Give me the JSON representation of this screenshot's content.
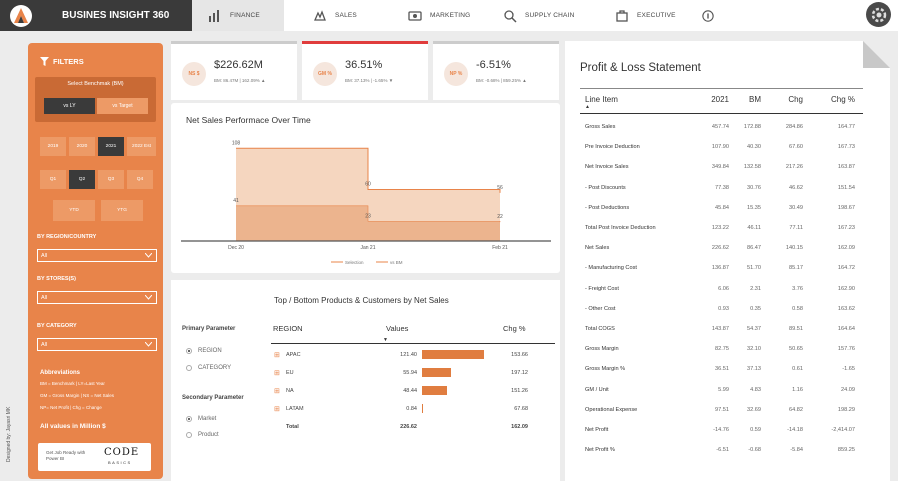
{
  "app": {
    "brand": "BUSINES INSIGHT 360"
  },
  "nav": {
    "tabs": [
      {
        "label": "FINANCE",
        "icon": "finance-icon"
      },
      {
        "label": "SALES",
        "icon": "sales-icon"
      },
      {
        "label": "MARKETING",
        "icon": "marketing-icon"
      },
      {
        "label": "SUPPLY CHAIN",
        "icon": "supply-chain-icon"
      },
      {
        "label": "EXECUTIVE",
        "icon": "executive-icon"
      }
    ]
  },
  "filters": {
    "title": "FILTERS",
    "benchmark_label": "Select Benchmak (BM)",
    "benchmark_options": [
      "vs LY",
      "vs Target"
    ],
    "years": [
      "2019",
      "2020",
      "2021",
      "2022 Est"
    ],
    "quarters": [
      "Q1",
      "Q2",
      "Q3",
      "Q4"
    ],
    "periods": [
      "YTD",
      "YTG"
    ],
    "region_label": "BY REGION/COUNTRY",
    "region_value": "All",
    "stores_label": "BY STORES(S)",
    "stores_value": "All",
    "category_label": "BY CATEGORY",
    "category_value": "All",
    "abbr_title": "Abbreviations",
    "abbr_lines": [
      "BM = Benchmark | LY=Last Year",
      "GM = Gross Margin | NS = Net Sales",
      "NP= Net Profit | Chg = Change"
    ],
    "values_note": "All values in Million $",
    "promo_text": "Get Job Ready with Power BI",
    "promo_logo": "CODE",
    "promo_sub": "BASICS",
    "designed_by": "Designed by: Jayasri MK"
  },
  "kpis": [
    {
      "badge": "NS $",
      "value": "$226.62M",
      "sub": "BM: 86.47M | 162.09% ▲"
    },
    {
      "badge": "GM %",
      "value": "36.51%",
      "sub": "BM: 37.13% | -1.65% ▼"
    },
    {
      "badge": "NP %",
      "value": "-6.51%",
      "sub": "BM: -0.68% | 859.25% ▲"
    }
  ],
  "chart_data": {
    "type": "area",
    "title": "Net Sales Performace Over Time",
    "categories": [
      "Dec 20",
      "Jan 21",
      "Feb 21"
    ],
    "series": [
      {
        "name": "Selection",
        "values": [
          108,
          60,
          56
        ]
      },
      {
        "name": "vs BM",
        "values": [
          41,
          23,
          22
        ]
      }
    ],
    "ylim": [
      0,
      120
    ],
    "grid": false,
    "legend": "bottom",
    "colors": {
      "Selection": "#f5d6bf",
      "vs BM": "#ecb48e",
      "line": "#e8844a"
    }
  },
  "params": {
    "primary_title": "Primary Parameter",
    "primary_options": [
      "REGION",
      "CATEGORY"
    ],
    "secondary_title": "Secondary Parameter",
    "secondary_options": [
      "Market",
      "Product"
    ]
  },
  "top_bottom": {
    "title": "Top / Bottom Products & Customers by Net Sales",
    "headers": {
      "dim": "REGION",
      "values": "Values",
      "chg": "Chg %"
    },
    "rows": [
      {
        "name": "APAC",
        "value": "121.40",
        "num": 121.4,
        "chg": "153.66"
      },
      {
        "name": "EU",
        "value": "55.94",
        "num": 55.94,
        "chg": "197.12"
      },
      {
        "name": "NA",
        "value": "48.44",
        "num": 48.44,
        "chg": "151.26"
      },
      {
        "name": "LATAM",
        "value": "0.84",
        "num": 0.84,
        "chg": "67.68"
      }
    ],
    "total": {
      "name": "Total",
      "value": "226.62",
      "chg": "162.09"
    }
  },
  "pl": {
    "title": "Profit & Loss Statement",
    "headers": [
      "Line Item",
      "2021",
      "BM",
      "Chg",
      "Chg %"
    ],
    "rows": [
      [
        "Gross Sales",
        "457.74",
        "172.88",
        "284.86",
        "164.77"
      ],
      [
        "Pre Invoice Deduction",
        "107.90",
        "40.30",
        "67.60",
        "167.73"
      ],
      [
        "Net Invoice Sales",
        "349.84",
        "132.58",
        "217.26",
        "163.87"
      ],
      [
        " - Post Discounts",
        "77.38",
        "30.76",
        "46.62",
        "151.54"
      ],
      [
        " - Post Deductions",
        "45.84",
        "15.35",
        "30.49",
        "198.67"
      ],
      [
        "Total Post Invoice Deduction",
        "123.22",
        "46.11",
        "77.11",
        "167.23"
      ],
      [
        "Net Sales",
        "226.62",
        "86.47",
        "140.15",
        "162.09"
      ],
      [
        " - Manufacturing Cost",
        "136.87",
        "51.70",
        "85.17",
        "164.72"
      ],
      [
        " - Freight Cost",
        "6.06",
        "2.31",
        "3.76",
        "162.90"
      ],
      [
        " - Other Cost",
        "0.93",
        "0.35",
        "0.58",
        "163.62"
      ],
      [
        "Total COGS",
        "143.87",
        "54.37",
        "89.51",
        "164.64"
      ],
      [
        "Gross Margin",
        "82.75",
        "32.10",
        "50.65",
        "157.76"
      ],
      [
        "Gross Margin %",
        "36.51",
        "37.13",
        "0.61",
        "-1.65"
      ],
      [
        "GM / Unit",
        "5.99",
        "4.83",
        "1.16",
        "24.09"
      ],
      [
        "Operational Expense",
        "97.51",
        "32.69",
        "64.82",
        "198.29"
      ],
      [
        "Net Profit",
        "-14.76",
        "0.59",
        "-14.18",
        "-2,414.07"
      ],
      [
        "Net Profit %",
        "-6.51",
        "-0.68",
        "-5.84",
        "859.25"
      ]
    ]
  }
}
